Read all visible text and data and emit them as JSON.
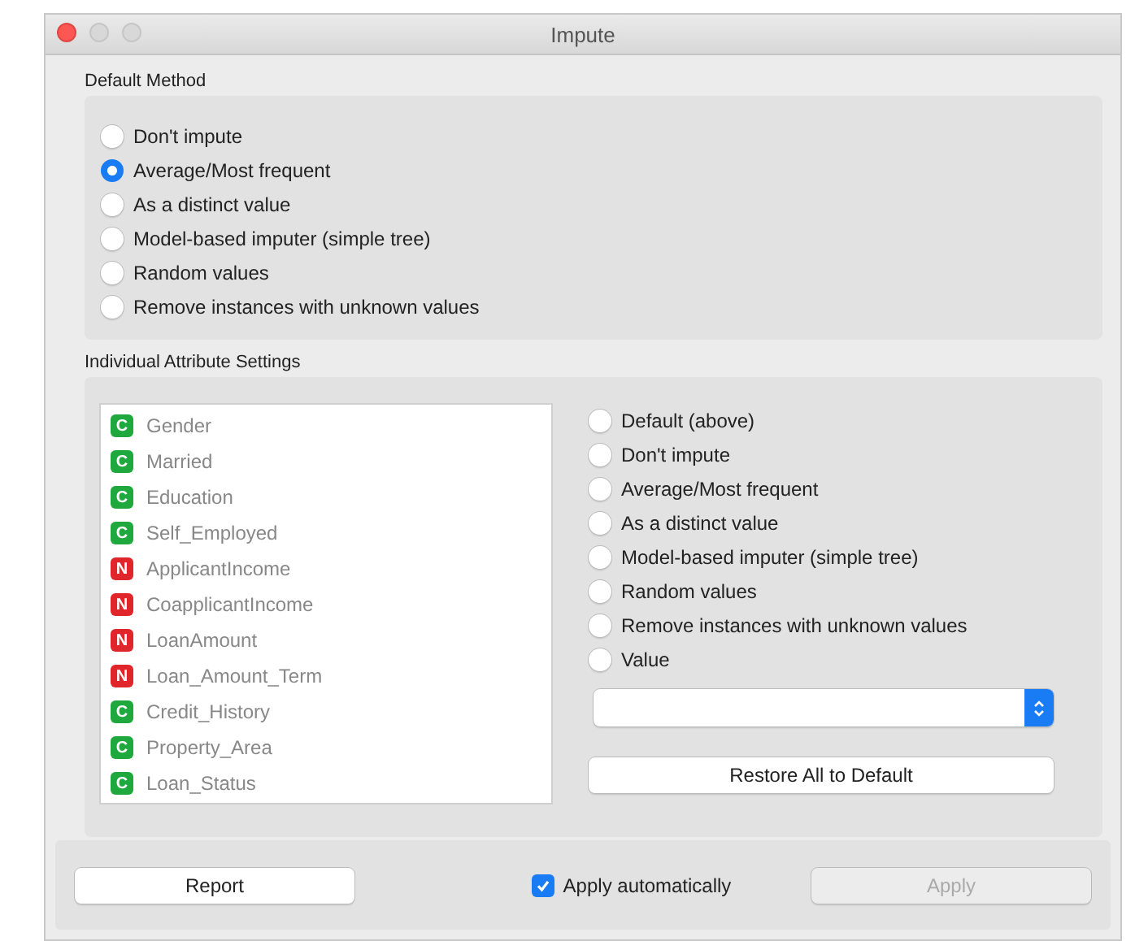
{
  "window": {
    "title": "Impute"
  },
  "default_method": {
    "title": "Default Method",
    "options": [
      {
        "label": "Don't impute",
        "selected": false
      },
      {
        "label": "Average/Most frequent",
        "selected": true
      },
      {
        "label": "As a distinct value",
        "selected": false
      },
      {
        "label": "Model-based imputer (simple tree)",
        "selected": false
      },
      {
        "label": "Random values",
        "selected": false
      },
      {
        "label": "Remove instances with unknown values",
        "selected": false
      }
    ]
  },
  "individual": {
    "title": "Individual Attribute Settings",
    "attributes": [
      {
        "badge": "C",
        "color": "#1fa83e",
        "name": "Gender"
      },
      {
        "badge": "C",
        "color": "#1fa83e",
        "name": "Married"
      },
      {
        "badge": "C",
        "color": "#1fa83e",
        "name": "Education"
      },
      {
        "badge": "C",
        "color": "#1fa83e",
        "name": "Self_Employed"
      },
      {
        "badge": "N",
        "color": "#e0262b",
        "name": "ApplicantIncome"
      },
      {
        "badge": "N",
        "color": "#e0262b",
        "name": "CoapplicantIncome"
      },
      {
        "badge": "N",
        "color": "#e0262b",
        "name": "LoanAmount"
      },
      {
        "badge": "N",
        "color": "#e0262b",
        "name": "Loan_Amount_Term"
      },
      {
        "badge": "C",
        "color": "#1fa83e",
        "name": "Credit_History"
      },
      {
        "badge": "C",
        "color": "#1fa83e",
        "name": "Property_Area"
      },
      {
        "badge": "C",
        "color": "#1fa83e",
        "name": "Loan_Status"
      }
    ],
    "options": [
      {
        "label": "Default (above)",
        "selected": false
      },
      {
        "label": "Don't impute",
        "selected": false
      },
      {
        "label": "Average/Most frequent",
        "selected": false
      },
      {
        "label": "As a distinct value",
        "selected": false
      },
      {
        "label": "Model-based imputer (simple tree)",
        "selected": false
      },
      {
        "label": "Random values",
        "selected": false
      },
      {
        "label": "Remove instances with unknown values",
        "selected": false
      },
      {
        "label": "Value",
        "selected": false
      }
    ],
    "restore_button": "Restore All to Default"
  },
  "footer": {
    "report_button": "Report",
    "auto_apply": {
      "label": "Apply automatically",
      "checked": true
    },
    "apply_button": {
      "label": "Apply",
      "disabled": true
    }
  }
}
